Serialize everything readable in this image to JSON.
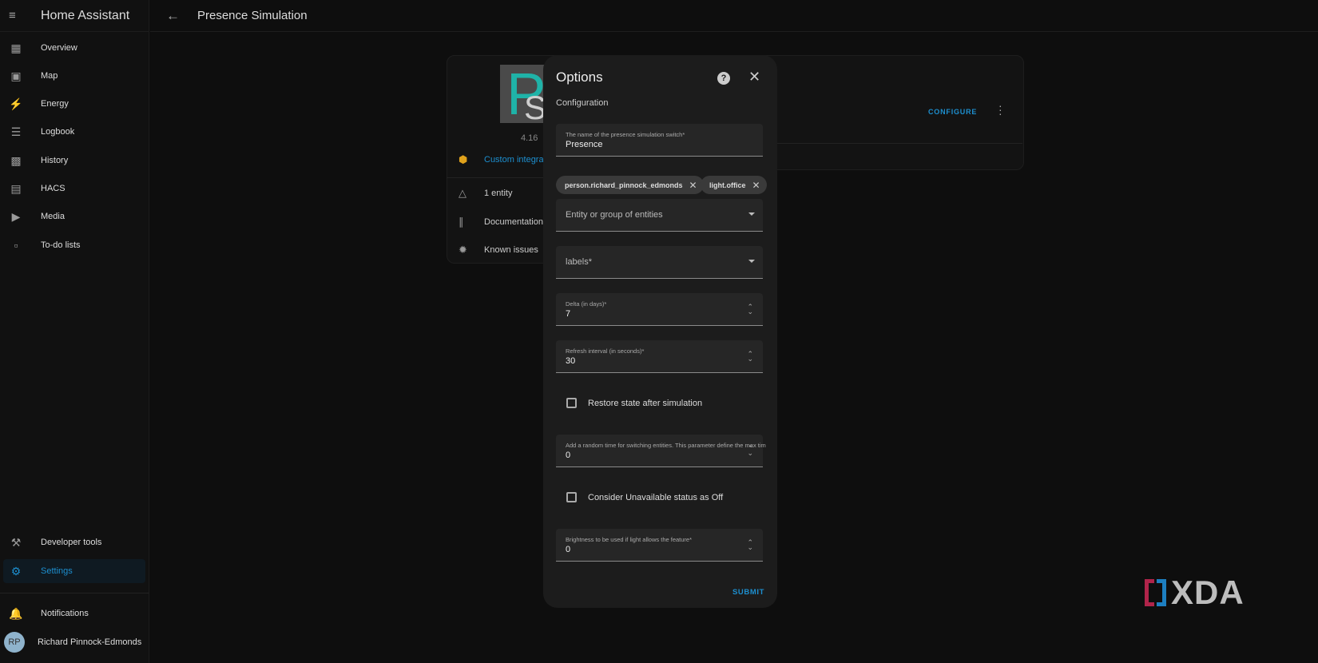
{
  "app_title": "Home Assistant",
  "sidebar": {
    "items": [
      {
        "label": "Overview",
        "icon": "dashboard-icon"
      },
      {
        "label": "Map",
        "icon": "map-icon"
      },
      {
        "label": "Energy",
        "icon": "lightning-icon"
      },
      {
        "label": "Logbook",
        "icon": "list-icon"
      },
      {
        "label": "History",
        "icon": "chart-icon"
      },
      {
        "label": "HACS",
        "icon": "hacs-icon"
      },
      {
        "label": "Media",
        "icon": "media-icon"
      },
      {
        "label": "To-do lists",
        "icon": "clipboard-icon"
      }
    ],
    "developer_tools": "Developer tools",
    "settings": "Settings",
    "notifications": "Notifications",
    "user": {
      "initials": "RP",
      "name": "Richard Pinnock-Edmonds"
    }
  },
  "header": {
    "title": "Presence Simulation"
  },
  "integration_card": {
    "version": "4.16",
    "custom_integration": "Custom integrat",
    "entities": "1 entity",
    "documentation": "Documentation",
    "known_issues": "Known issues",
    "configure": "CONFIGURE"
  },
  "dialog": {
    "title": "Options",
    "subtitle": "Configuration",
    "name_field": {
      "label": "The name of the presence simulation switch*",
      "value": "Presence"
    },
    "chips": [
      "person.richard_pinnock_edmonds",
      "light.office"
    ],
    "entity_field": {
      "placeholder": "Entity or group of entities"
    },
    "labels_field": {
      "placeholder": "labels*"
    },
    "delta_field": {
      "label": "Delta (in days)*",
      "value": "7"
    },
    "refresh_field": {
      "label": "Refresh interval (in seconds)*",
      "value": "30"
    },
    "restore_checkbox": {
      "label": "Restore state after simulation",
      "checked": false
    },
    "random_field": {
      "label": "Add a random time for switching entities. This parameter define the max tim",
      "value": "0"
    },
    "unavailable_checkbox": {
      "label": "Consider Unavailable status as Off",
      "checked": false
    },
    "brightness_field": {
      "label": "Brightness to be used if light allows the feature*",
      "value": "0"
    },
    "submit": "SUBMIT"
  },
  "watermark": "XDA",
  "colors": {
    "accent": "#1d8fcf",
    "background": "#0e0e0e",
    "dialog": "#1c1c1c"
  }
}
